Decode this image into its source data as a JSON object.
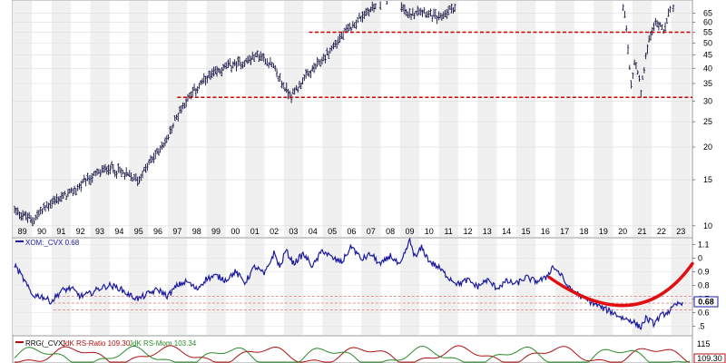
{
  "chart_data": [
    {
      "type": "bar",
      "panel": "price",
      "scale": "log",
      "ylim": [
        9,
        73
      ],
      "x_range": [
        1988.5,
        2023.6
      ],
      "x_tick_labels": [
        "89",
        "90",
        "91",
        "92",
        "93",
        "94",
        "95",
        "96",
        "97",
        "98",
        "99",
        "00",
        "01",
        "02",
        "03",
        "04",
        "05",
        "06",
        "07",
        "08",
        "09",
        "10",
        "11",
        "12",
        "13",
        "14",
        "15",
        "16",
        "17",
        "18",
        "19",
        "20",
        "21",
        "22",
        "23"
      ],
      "y_ticks": [
        10,
        15,
        20,
        25,
        30,
        35,
        40,
        45,
        50,
        55,
        60,
        65
      ],
      "y_tick_labels": [
        "10",
        "15",
        "20",
        "25",
        "30",
        "35",
        "40",
        "45",
        "50",
        "55",
        "60",
        "65"
      ],
      "support_lines": [
        {
          "value": 55,
          "x_start": 2003.8,
          "x_end": 2023.6,
          "color": "#cc0000"
        },
        {
          "value": 31,
          "x_start": 1997.0,
          "x_end": 2023.6,
          "color": "#cc0000"
        }
      ],
      "anchors": [
        [
          1988.6,
          11.5
        ],
        [
          1989.5,
          10.5
        ],
        [
          1990.5,
          12.3
        ],
        [
          1991.5,
          13.3
        ],
        [
          1992.5,
          15.2
        ],
        [
          1993.5,
          16.8
        ],
        [
          1994.5,
          15.5
        ],
        [
          1995.0,
          15.0
        ],
        [
          1995.6,
          17.5
        ],
        [
          1996.5,
          21.5
        ],
        [
          1997.0,
          26.5
        ],
        [
          1997.5,
          30.5
        ],
        [
          1998.5,
          36.5
        ],
        [
          1999.5,
          40.5
        ],
        [
          2000.5,
          42.5
        ],
        [
          2001.2,
          45.0
        ],
        [
          2001.8,
          42.0
        ],
        [
          2002.5,
          34.0
        ],
        [
          2002.9,
          31.5
        ],
        [
          2003.5,
          36.0
        ],
        [
          2004.5,
          43.0
        ],
        [
          2005.5,
          53.0
        ],
        [
          2006.5,
          63.0
        ],
        [
          2007.5,
          72.0
        ],
        [
          2008.4,
          75.0
        ],
        [
          2008.9,
          63.0
        ],
        [
          2009.5,
          68.0
        ],
        [
          2010.5,
          62.0
        ],
        [
          2011.5,
          71.0
        ],
        [
          2012.5,
          75.0
        ],
        [
          2014.0,
          76.0
        ],
        [
          2015.5,
          75.0
        ],
        [
          2016.5,
          76.0
        ],
        [
          2017.5,
          76.0
        ],
        [
          2018.5,
          76.0
        ],
        [
          2019.5,
          76.0
        ],
        [
          2019.9,
          72.0
        ],
        [
          2020.1,
          65.0
        ],
        [
          2020.3,
          45.0
        ],
        [
          2020.45,
          33.0
        ],
        [
          2020.6,
          42.0
        ],
        [
          2020.8,
          38.0
        ],
        [
          2020.95,
          32.0
        ],
        [
          2021.2,
          45.0
        ],
        [
          2021.6,
          58.0
        ],
        [
          2021.9,
          60.0
        ],
        [
          2022.1,
          56.0
        ],
        [
          2022.4,
          66.0
        ],
        [
          2022.7,
          72.0
        ]
      ]
    },
    {
      "type": "line",
      "panel": "ratio",
      "legend": "XOM:_CVX 0.68",
      "color": "#1a1aa0",
      "ylim": [
        0.43,
        1.15
      ],
      "last_value": 0.68,
      "last_value_label": "0.68",
      "y_ticks": [
        0.5,
        0.6,
        0.7,
        0.8,
        0.9,
        1.0,
        1.1
      ],
      "y_tick_labels": [
        ".5",
        "0.6",
        "0.7",
        "0.8",
        "0.9",
        "0",
        "1.1"
      ],
      "ref_lines": [
        0.72,
        0.67,
        0.62
      ],
      "anchors": [
        [
          1988.6,
          0.95
        ],
        [
          1989.0,
          0.86
        ],
        [
          1989.5,
          0.73
        ],
        [
          1990.0,
          0.72
        ],
        [
          1990.5,
          0.68
        ],
        [
          1991.0,
          0.76
        ],
        [
          1991.5,
          0.78
        ],
        [
          1992.0,
          0.72
        ],
        [
          1992.5,
          0.74
        ],
        [
          1993.0,
          0.78
        ],
        [
          1993.5,
          0.8
        ],
        [
          1994.0,
          0.78
        ],
        [
          1994.5,
          0.73
        ],
        [
          1995.0,
          0.7
        ],
        [
          1995.5,
          0.74
        ],
        [
          1996.0,
          0.77
        ],
        [
          1996.5,
          0.72
        ],
        [
          1997.0,
          0.8
        ],
        [
          1997.5,
          0.83
        ],
        [
          1998.0,
          0.77
        ],
        [
          1998.5,
          0.85
        ],
        [
          1999.0,
          0.87
        ],
        [
          1999.5,
          0.84
        ],
        [
          2000.0,
          0.9
        ],
        [
          2000.5,
          0.82
        ],
        [
          2001.0,
          0.94
        ],
        [
          2001.5,
          0.88
        ],
        [
          2002.0,
          1.04
        ],
        [
          2002.3,
          0.93
        ],
        [
          2002.6,
          1.06
        ],
        [
          2003.0,
          0.96
        ],
        [
          2003.5,
          1.03
        ],
        [
          2004.0,
          0.94
        ],
        [
          2004.5,
          1.06
        ],
        [
          2005.0,
          1.0
        ],
        [
          2005.5,
          0.97
        ],
        [
          2006.0,
          1.09
        ],
        [
          2006.5,
          0.99
        ],
        [
          2007.0,
          1.03
        ],
        [
          2007.5,
          0.95
        ],
        [
          2008.0,
          1.02
        ],
        [
          2008.5,
          0.94
        ],
        [
          2009.0,
          1.13
        ],
        [
          2009.3,
          1.0
        ],
        [
          2009.6,
          1.08
        ],
        [
          2010.0,
          0.98
        ],
        [
          2010.5,
          0.93
        ],
        [
          2011.0,
          0.86
        ],
        [
          2011.5,
          0.81
        ],
        [
          2012.0,
          0.84
        ],
        [
          2012.5,
          0.79
        ],
        [
          2013.0,
          0.84
        ],
        [
          2013.5,
          0.78
        ],
        [
          2014.0,
          0.83
        ],
        [
          2014.5,
          0.81
        ],
        [
          2015.0,
          0.86
        ],
        [
          2015.5,
          0.83
        ],
        [
          2016.0,
          0.85
        ],
        [
          2016.4,
          0.94
        ],
        [
          2016.8,
          0.88
        ],
        [
          2017.2,
          0.78
        ],
        [
          2017.6,
          0.75
        ],
        [
          2018.0,
          0.7
        ],
        [
          2018.5,
          0.67
        ],
        [
          2019.0,
          0.63
        ],
        [
          2019.5,
          0.6
        ],
        [
          2020.0,
          0.56
        ],
        [
          2020.5,
          0.54
        ],
        [
          2020.9,
          0.49
        ],
        [
          2021.2,
          0.56
        ],
        [
          2021.6,
          0.52
        ],
        [
          2022.0,
          0.58
        ],
        [
          2022.4,
          0.61
        ],
        [
          2022.8,
          0.66
        ],
        [
          2023.1,
          0.68
        ]
      ],
      "trend_curve": {
        "color": "#e01010",
        "points": [
          [
            2016.2,
            0.86
          ],
          [
            2020.8,
            0.4
          ],
          [
            2023.6,
            0.96
          ]
        ]
      }
    },
    {
      "type": "line",
      "panel": "rrg",
      "legend_prefix": "RRG(_CVX)",
      "legend_ratio": "JdK RS-Ratio 109.30",
      "legend_mom": "JdK RS-Mom 103.34",
      "ratio_color": "#b01010",
      "mom_color": "#2a8a2a",
      "axis_labels": [
        "115",
        "109.30"
      ]
    }
  ]
}
